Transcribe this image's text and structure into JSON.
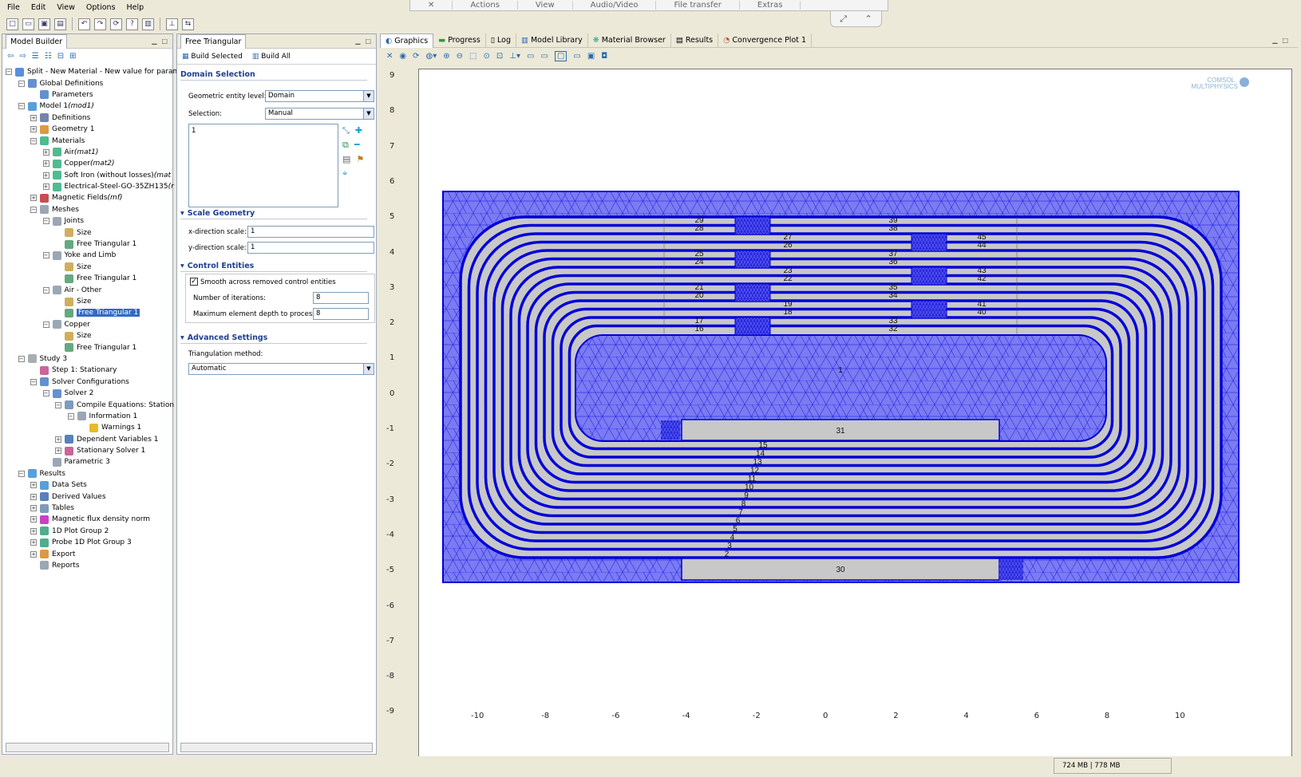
{
  "menu": [
    "File",
    "Edit",
    "View",
    "Options",
    "Help"
  ],
  "remote_bar": [
    "✕",
    "Actions",
    "View",
    "Audio/Video",
    "File transfer",
    "Extras"
  ],
  "model_builder": {
    "title": "Model Builder",
    "tree": [
      {
        "label": "Split - New Material - New value for parame",
        "indent": 0,
        "exp": "-",
        "icon": "model-root-icon",
        "color": "#3a7bd5"
      },
      {
        "label": "Global Definitions",
        "indent": 1,
        "exp": "-",
        "icon": "global-definitions-icon",
        "color": "#4a7cc7"
      },
      {
        "label": "Parameters",
        "indent": 2,
        "exp": "",
        "icon": "parameters-icon",
        "color": "#4a7cc7"
      },
      {
        "label": "Model 1 ",
        "italic": "(mod1)",
        "indent": 1,
        "exp": "-",
        "icon": "model-icon",
        "color": "#3a8fd5"
      },
      {
        "label": "Definitions",
        "indent": 2,
        "exp": "+",
        "icon": "definitions-icon",
        "color": "#5a6fa0"
      },
      {
        "label": "Geometry 1",
        "indent": 2,
        "exp": "+",
        "icon": "geometry-icon",
        "color": "#d08a2a"
      },
      {
        "label": "Materials",
        "indent": 2,
        "exp": "-",
        "icon": "materials-icon",
        "color": "#2fb07a"
      },
      {
        "label": "Air ",
        "italic": "(mat1)",
        "indent": 3,
        "exp": "+",
        "icon": "material-icon",
        "color": "#2fb07a"
      },
      {
        "label": "Copper ",
        "italic": "(mat2)",
        "indent": 3,
        "exp": "+",
        "icon": "material-icon",
        "color": "#2fb07a"
      },
      {
        "label": "Soft Iron (without losses) ",
        "italic": "(mat",
        "indent": 3,
        "exp": "+",
        "icon": "material-icon",
        "color": "#2fb07a"
      },
      {
        "label": "Electrical-Steel-GO-35ZH135 ",
        "italic": "(r",
        "indent": 3,
        "exp": "+",
        "icon": "material-icon",
        "color": "#2fb07a"
      },
      {
        "label": "Magnetic Fields ",
        "italic": "(mf)",
        "indent": 2,
        "exp": "+",
        "icon": "magnetic-fields-icon",
        "color": "#c03030"
      },
      {
        "label": "Meshes",
        "indent": 2,
        "exp": "-",
        "icon": "meshes-icon",
        "color": "#8a98a8"
      },
      {
        "label": "Joints",
        "indent": 3,
        "exp": "-",
        "icon": "mesh-icon",
        "color": "#8a98a8"
      },
      {
        "label": "Size",
        "indent": 4,
        "exp": "",
        "icon": "size-icon",
        "color": "#c9a040"
      },
      {
        "label": "Free Triangular 1",
        "indent": 4,
        "exp": "",
        "icon": "free-triangular-icon",
        "color": "#4a9a6a"
      },
      {
        "label": "Yoke and Limb",
        "indent": 3,
        "exp": "-",
        "icon": "mesh-icon",
        "color": "#8a98a8"
      },
      {
        "label": "Size",
        "indent": 4,
        "exp": "",
        "icon": "size-icon",
        "color": "#c9a040"
      },
      {
        "label": "Free Triangular 1",
        "indent": 4,
        "exp": "",
        "icon": "free-triangular-icon",
        "color": "#4a9a6a"
      },
      {
        "label": "Air - Other",
        "indent": 3,
        "exp": "-",
        "icon": "mesh-icon",
        "color": "#8a98a8"
      },
      {
        "label": "Size",
        "indent": 4,
        "exp": "",
        "icon": "size-icon",
        "color": "#c9a040"
      },
      {
        "label": "Free Triangular 1",
        "indent": 4,
        "exp": "",
        "icon": "free-triangular-icon",
        "color": "#4a9a6a",
        "selected": true
      },
      {
        "label": "Copper",
        "indent": 3,
        "exp": "-",
        "icon": "mesh-icon",
        "color": "#8a98a8"
      },
      {
        "label": "Size",
        "indent": 4,
        "exp": "",
        "icon": "size-icon",
        "color": "#c9a040"
      },
      {
        "label": "Free Triangular 1",
        "indent": 4,
        "exp": "",
        "icon": "free-triangular-icon",
        "color": "#4a9a6a"
      },
      {
        "label": "Study 3",
        "indent": 1,
        "exp": "-",
        "icon": "study-icon",
        "color": "#9aa0a8"
      },
      {
        "label": "Step 1: Stationary",
        "indent": 2,
        "exp": "",
        "icon": "step-icon",
        "color": "#c04a8a"
      },
      {
        "label": "Solver Configurations",
        "indent": 2,
        "exp": "-",
        "icon": "solver-configurations-icon",
        "color": "#4a7cc7"
      },
      {
        "label": "Solver 2",
        "indent": 3,
        "exp": "-",
        "icon": "solver-icon",
        "color": "#4a7cc7"
      },
      {
        "label": "Compile Equations: Station",
        "indent": 4,
        "exp": "-",
        "icon": "compile-equations-icon",
        "color": "#6a8ab0"
      },
      {
        "label": "Information 1",
        "indent": 5,
        "exp": "-",
        "icon": "information-icon",
        "color": "#8a98a8"
      },
      {
        "label": "Warnings 1",
        "indent": 6,
        "exp": "",
        "icon": "warning-icon",
        "color": "#e0b000"
      },
      {
        "label": "Dependent Variables 1",
        "indent": 4,
        "exp": "+",
        "icon": "dependent-variables-icon",
        "color": "#3a6ab0"
      },
      {
        "label": "Stationary Solver 1",
        "indent": 4,
        "exp": "+",
        "icon": "stationary-solver-icon",
        "color": "#c04a8a"
      },
      {
        "label": "Parametric 3",
        "indent": 3,
        "exp": "",
        "icon": "parametric-icon",
        "color": "#8a98a8"
      },
      {
        "label": "Results",
        "indent": 1,
        "exp": "-",
        "icon": "results-icon",
        "color": "#3a8fd5"
      },
      {
        "label": "Data Sets",
        "indent": 2,
        "exp": "+",
        "icon": "data-sets-icon",
        "color": "#3a8fd5"
      },
      {
        "label": "Derived Values",
        "indent": 2,
        "exp": "+",
        "icon": "derived-values-icon",
        "color": "#3a6ab0"
      },
      {
        "label": "Tables",
        "indent": 2,
        "exp": "+",
        "icon": "tables-icon",
        "color": "#6a8ab0"
      },
      {
        "label": "Magnetic flux density norm",
        "indent": 2,
        "exp": "+",
        "icon": "plot-2d-icon",
        "color": "#c020c0"
      },
      {
        "label": "1D Plot Group 2",
        "indent": 2,
        "exp": "+",
        "icon": "plot-1d-icon",
        "color": "#2fa07a"
      },
      {
        "label": "Probe 1D Plot Group 3",
        "indent": 2,
        "exp": "+",
        "icon": "plot-1d-icon",
        "color": "#2fa07a"
      },
      {
        "label": "Export",
        "indent": 2,
        "exp": "+",
        "icon": "export-icon",
        "color": "#d08a2a"
      },
      {
        "label": "Reports",
        "indent": 2,
        "exp": "",
        "icon": "reports-icon",
        "color": "#8a98a8"
      }
    ]
  },
  "settings": {
    "title": "Free Triangular",
    "build_selected": "Build Selected",
    "build_all": "Build All",
    "domain_selection": "Domain Selection",
    "geom_entity_label": "Geometric entity level:",
    "geom_entity_value": "Domain",
    "selection_label": "Selection:",
    "selection_value": "Manual",
    "selection_list": "1",
    "scale_geometry": "Scale Geometry",
    "x_scale_label": "x-direction scale:",
    "x_scale_value": "1",
    "y_scale_label": "y-direction scale:",
    "y_scale_value": "1",
    "control_entities": "Control Entities",
    "smooth_label": "Smooth across removed control entities",
    "iterations_label": "Number of iterations:",
    "iterations_value": "8",
    "depth_label": "Maximum element depth to process:",
    "depth_value": "8",
    "advanced_settings": "Advanced Settings",
    "triangulation_label": "Triangulation method:",
    "triangulation_value": "Automatic"
  },
  "graphics": {
    "tabs": [
      "Graphics",
      "Progress",
      "Log",
      "Model Library",
      "Material Browser",
      "Results",
      "Convergence Plot 1"
    ],
    "logo_line1": "COMSOL",
    "logo_line2": "MULTIPHYSICS",
    "x_ticks": [
      "-10",
      "-8",
      "-6",
      "-4",
      "-2",
      "0",
      "2",
      "4",
      "6",
      "8",
      "10"
    ],
    "y_ticks": [
      "9",
      "8",
      "7",
      "6",
      "5",
      "4",
      "3",
      "2",
      "1",
      "0",
      "-1",
      "-2",
      "-3",
      "-4",
      "-5",
      "-6",
      "-7",
      "-8",
      "-9"
    ],
    "domain_labels_left": [
      "29",
      "28",
      "25",
      "24",
      "21",
      "20",
      "17",
      "16"
    ],
    "domain_labels_mid": [
      "27",
      "26",
      "23",
      "22",
      "19",
      "18"
    ],
    "domain_labels_right": [
      "39",
      "38",
      "37",
      "36",
      "35",
      "34",
      "33",
      "32"
    ],
    "domain_labels_far": [
      "45",
      "44",
      "43",
      "42",
      "41",
      "40"
    ],
    "bottom_labels": [
      "15",
      "14",
      "13",
      "12",
      "11",
      "10",
      "9",
      "8",
      "7",
      "6",
      "5",
      "4",
      "3",
      "2"
    ],
    "bar_label_31": "31",
    "bar_label_30": "30",
    "center_label": "1",
    "colors": {
      "mesh_fill": "#7b7bf2",
      "mesh_line": "#0000d8",
      "coil_fill": "#c8c8c8"
    }
  },
  "status": {
    "memory": "724 MB | 778 MB"
  }
}
